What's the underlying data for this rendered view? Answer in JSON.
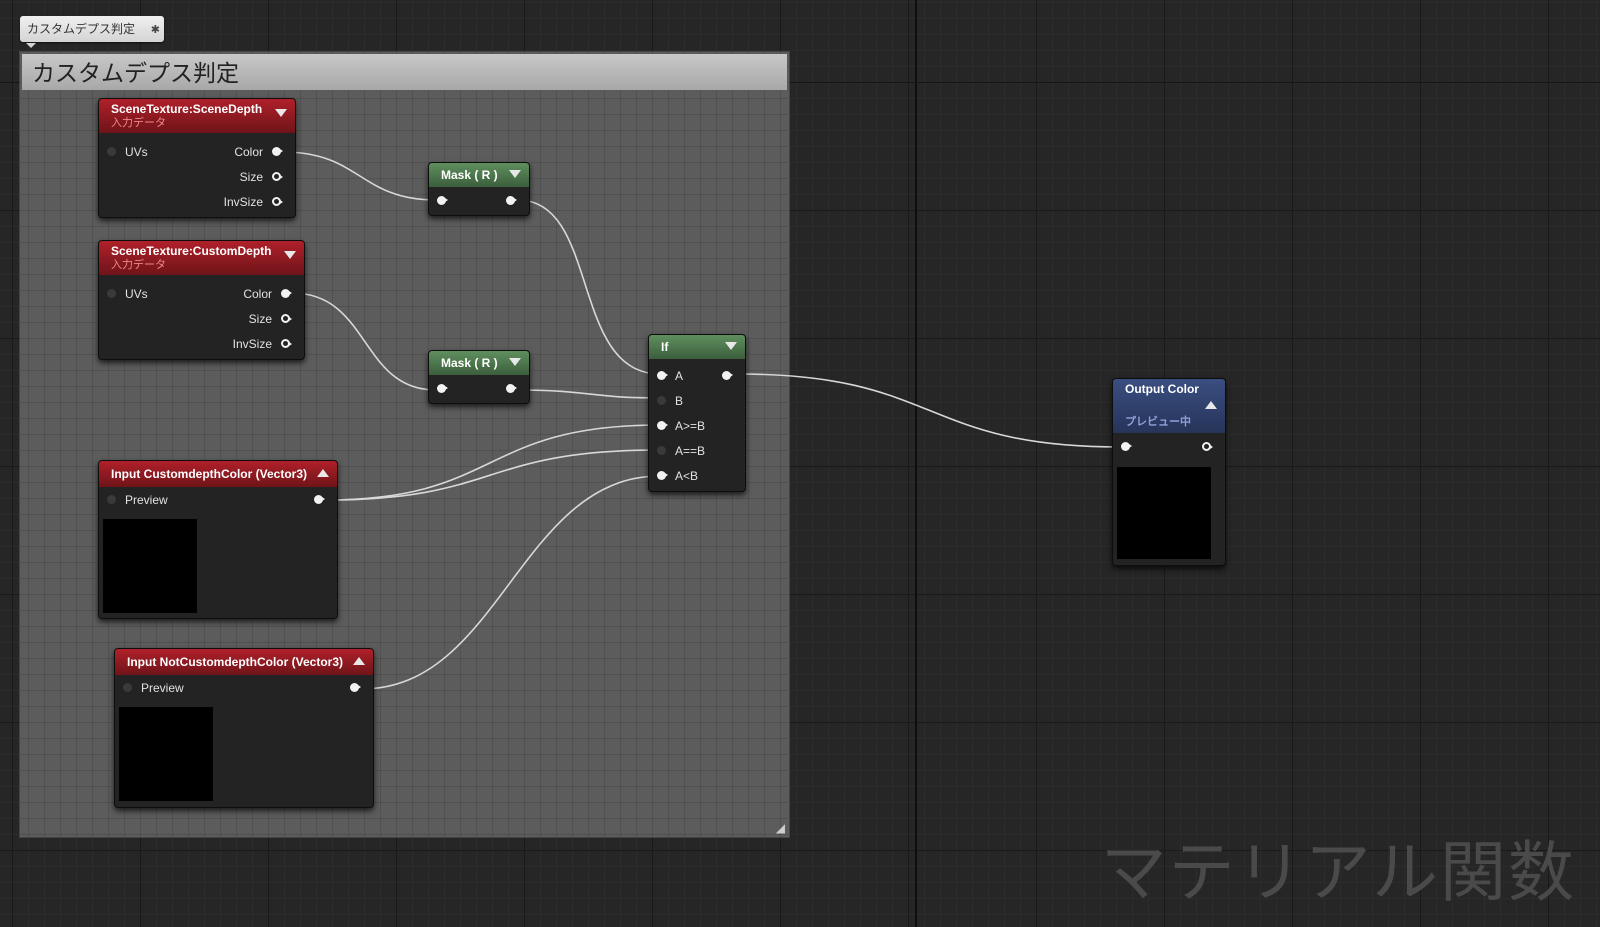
{
  "watermark": "マテリアル関数",
  "comment": {
    "tag_label": "カスタムデプス判定",
    "header": "カスタムデプス判定"
  },
  "nodes": {
    "scene_depth": {
      "title": "SceneTexture:SceneDepth",
      "subtitle": "入力データ",
      "inputs": [
        "UVs"
      ],
      "outputs": [
        "Color",
        "Size",
        "InvSize"
      ]
    },
    "custom_depth": {
      "title": "SceneTexture:CustomDepth",
      "subtitle": "入力データ",
      "inputs": [
        "UVs"
      ],
      "outputs": [
        "Color",
        "Size",
        "InvSize"
      ]
    },
    "mask_1": {
      "title": "Mask ( R )"
    },
    "mask_2": {
      "title": "Mask ( R )"
    },
    "if_node": {
      "title": "If",
      "inputs": [
        "A",
        "B",
        "A>=B",
        "A==B",
        "A<B"
      ]
    },
    "input_custom": {
      "title": "Input CustomdepthColor (Vector3)",
      "pin": "Preview"
    },
    "input_not_custom": {
      "title": "Input NotCustomdepthColor (Vector3)",
      "pin": "Preview"
    },
    "output_color": {
      "title": "Output Color",
      "subtitle": "プレビュー中"
    }
  }
}
